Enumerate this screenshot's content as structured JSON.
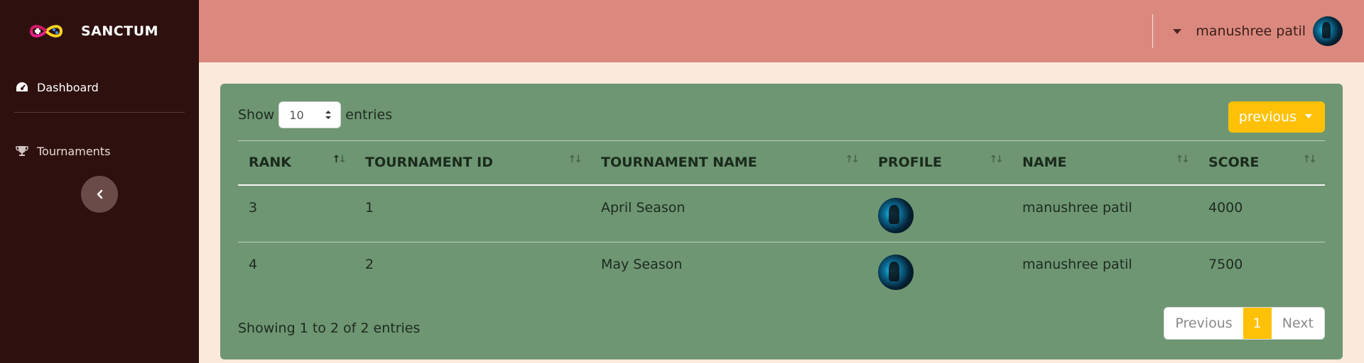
{
  "brand": {
    "name": "SANCTUM",
    "logo_icon": "gamepad-infinity-logo"
  },
  "sidebar": {
    "items": [
      {
        "label": "Dashboard",
        "icon": "speedometer-icon"
      },
      {
        "label": "Tournaments",
        "icon": "trophy-icon"
      }
    ],
    "collapse_icon": "chevron-left-icon"
  },
  "topbar": {
    "user_name": "manushree patil",
    "dropdown_icon": "caret-down-icon"
  },
  "table_controls": {
    "show_label": "Show",
    "entries_value": "10",
    "entries_label": "entries",
    "filter_button": "previous"
  },
  "table": {
    "columns": [
      "RANK",
      "TOURNAMENT ID",
      "TOURNAMENT NAME",
      "PROFILE",
      "NAME",
      "SCORE"
    ],
    "rows": [
      {
        "rank": "3",
        "tournament_id": "1",
        "tournament_name": "April Season",
        "name": "manushree patil",
        "score": "4000"
      },
      {
        "rank": "4",
        "tournament_id": "2",
        "tournament_name": "May Season",
        "name": "manushree patil",
        "score": "7500"
      }
    ]
  },
  "footer": {
    "info": "Showing 1 to 2 of 2 entries",
    "pagination": {
      "previous": "Previous",
      "current": "1",
      "next": "Next"
    }
  },
  "colors": {
    "sidebar_bg": "#2e110f",
    "topbar_bg": "#db897e",
    "page_bg": "#fbe9dc",
    "card_bg": "#6e9673",
    "accent": "#ffc107"
  }
}
